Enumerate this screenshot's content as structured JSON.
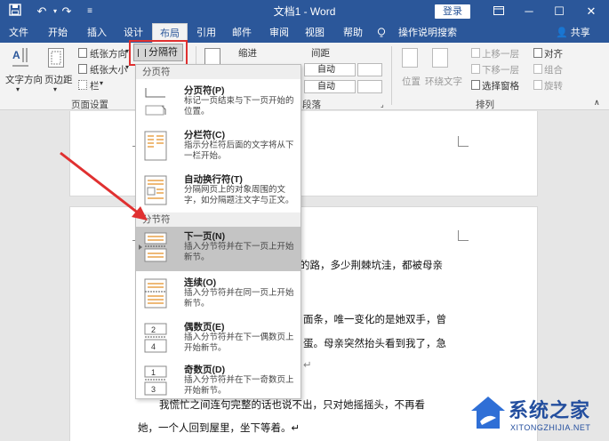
{
  "window": {
    "title": "文档1 - Word",
    "login_label": "登录"
  },
  "tabs": [
    {
      "label": "文件"
    },
    {
      "label": "开始"
    },
    {
      "label": "插入"
    },
    {
      "label": "设计"
    },
    {
      "label": "布局"
    },
    {
      "label": "引用"
    },
    {
      "label": "邮件"
    },
    {
      "label": "审阅"
    },
    {
      "label": "视图"
    },
    {
      "label": "帮助"
    },
    {
      "label": "操作说明搜索"
    }
  ],
  "share_label": "共享",
  "ribbon": {
    "text_direction": "文字方向",
    "margins": "页边距",
    "orientation": "纸张方向",
    "size": "纸张大小",
    "columns": "栏",
    "breaks": "分隔符",
    "page_setup_group": "页面设置",
    "indent_label": "缩进",
    "spacing_label": "间距",
    "spacing_before": "自动",
    "spacing_after": "自动",
    "paragraph_group_partial": "段落",
    "position": "位置",
    "wrap_text": "环绕文字",
    "bring_forward": "上移一层",
    "send_backward": "下移一层",
    "selection_pane": "选择窗格",
    "align": "对齐",
    "group": "组合",
    "rotate": "旋转",
    "arrange_group": "排列"
  },
  "dropdown": {
    "page_breaks_header": "分页符",
    "section_breaks_header": "分节符",
    "items": [
      {
        "title": "分页符(P)",
        "desc": "标记一页结束与下一页开始的位置。"
      },
      {
        "title": "分栏符(C)",
        "desc": "指示分栏符后面的文字将从下一栏开始。"
      },
      {
        "title": "自动换行符(T)",
        "desc": "分隔网页上的对象周围的文字，如分隔题注文字与正文。"
      },
      {
        "title": "下一页(N)",
        "desc": "插入分节符并在下一页上开始新节。"
      },
      {
        "title": "连续(O)",
        "desc": "插入分节符并在同一页上开始新节。"
      },
      {
        "title": "偶数页(E)",
        "desc": "插入分节符并在下一偶数页上开始新节。"
      },
      {
        "title": "奇数页(D)",
        "desc": "插入分节符并在下一奇数页上开始新节。"
      }
    ]
  },
  "document": {
    "lines": [
      "的路，多少荆棘坑洼，都被母亲",
      "面条，唯一变化的是她双手，曾",
      "蛋。母亲突然抬头看到我了，急",
      "我慌忙之间连句完整的话也说不出，只对她摇摇头，不再看",
      "她，一个人回到屋里，坐下等着。↵"
    ],
    "pilcrow": "↵"
  },
  "watermark": {
    "title": "系统之家",
    "subtitle": "XITONGZHIJIA.NET"
  },
  "colors": {
    "titlebar": "#2b579a",
    "highlight_box": "#e03030",
    "arrow": "#e03030",
    "menu_hover": "#c4c4c4"
  }
}
